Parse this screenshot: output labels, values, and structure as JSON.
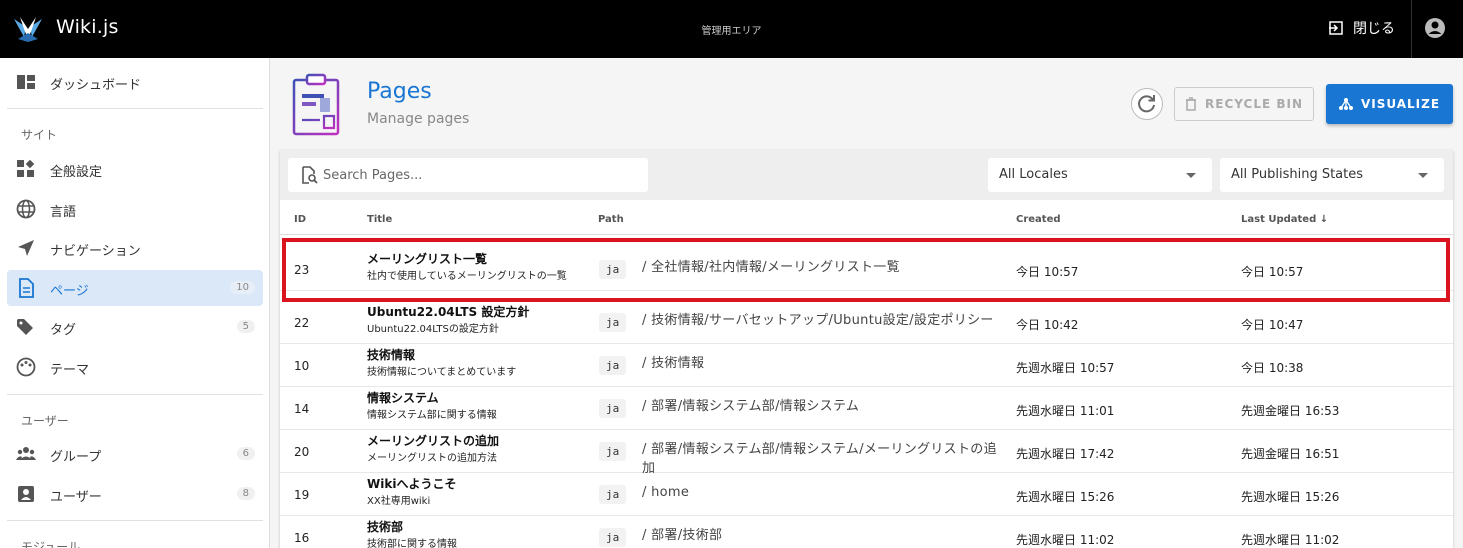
{
  "topbar": {
    "brand": "Wiki.js",
    "area_title": "管理用エリア",
    "close_label": "閉じる"
  },
  "sidebar": {
    "items_top": [
      {
        "label": "ダッシュボード",
        "icon": "dashboard-icon"
      }
    ],
    "site_header": "サイト",
    "site_items": [
      {
        "label": "全般設定",
        "icon": "widgets-icon"
      },
      {
        "label": "言語",
        "icon": "globe-icon"
      },
      {
        "label": "ナビゲーション",
        "icon": "navigation-icon"
      },
      {
        "label": "ページ",
        "icon": "page-icon",
        "count": "10",
        "active": true
      },
      {
        "label": "タグ",
        "icon": "tag-icon",
        "count": "5"
      },
      {
        "label": "テーマ",
        "icon": "palette-icon"
      }
    ],
    "users_header": "ユーザー",
    "user_items": [
      {
        "label": "グループ",
        "icon": "group-icon",
        "count": "6"
      },
      {
        "label": "ユーザー",
        "icon": "user-icon",
        "count": "8"
      }
    ],
    "modules_header": "モジュール"
  },
  "header": {
    "title": "Pages",
    "subtitle": "Manage pages",
    "recycle_label": "RECYCLE BIN",
    "visualize_label": "VISUALIZE"
  },
  "filters": {
    "search_placeholder": "Search Pages...",
    "locale": "All Locales",
    "publishing": "All Publishing States"
  },
  "table": {
    "columns": [
      "ID",
      "Title",
      "Path",
      "Created",
      "Last Updated"
    ],
    "sort_indicator": "↓",
    "rows": [
      {
        "id": "23",
        "title": "メーリングリスト一覧",
        "desc": "社内で使用しているメーリングリストの一覧",
        "locale": "ja",
        "path": "/ 全社情報/社内情報/メーリングリスト一覧",
        "created": "今日 10:57",
        "updated": "今日 10:57"
      },
      {
        "id": "22",
        "title": "Ubuntu22.04LTS 設定方針",
        "desc": "Ubuntu22.04LTSの設定方針",
        "locale": "ja",
        "path": "/ 技術情報/サーバセットアップ/Ubuntu設定/設定ポリシー",
        "created": "今日 10:42",
        "updated": "今日 10:47"
      },
      {
        "id": "10",
        "title": "技術情報",
        "desc": "技術情報についてまとめています",
        "locale": "ja",
        "path": "/ 技術情報",
        "created": "先週水曜日 10:57",
        "updated": "今日 10:38"
      },
      {
        "id": "14",
        "title": "情報システム",
        "desc": "情報システム部に関する情報",
        "locale": "ja",
        "path": "/ 部署/情報システム部/情報システム",
        "created": "先週水曜日 11:01",
        "updated": "先週金曜日 16:53"
      },
      {
        "id": "20",
        "title": "メーリングリストの追加",
        "desc": "メーリングリストの追加方法",
        "locale": "ja",
        "path": "/ 部署/情報システム部/情報システム/メーリングリストの追加",
        "created": "先週水曜日 17:42",
        "updated": "先週金曜日 16:51"
      },
      {
        "id": "19",
        "title": "Wikiへようこそ",
        "desc": "XX社専用wiki",
        "locale": "ja",
        "path": "/ home",
        "created": "先週水曜日 15:26",
        "updated": "先週水曜日 15:26"
      },
      {
        "id": "16",
        "title": "技術部",
        "desc": "技術部に関する情報",
        "locale": "ja",
        "path": "/ 部署/技術部",
        "created": "先週水曜日 11:02",
        "updated": "先週水曜日 11:02"
      }
    ]
  },
  "colors": {
    "accent": "#1976d2",
    "highlight": "#d9141f",
    "topbar": "#000000"
  }
}
